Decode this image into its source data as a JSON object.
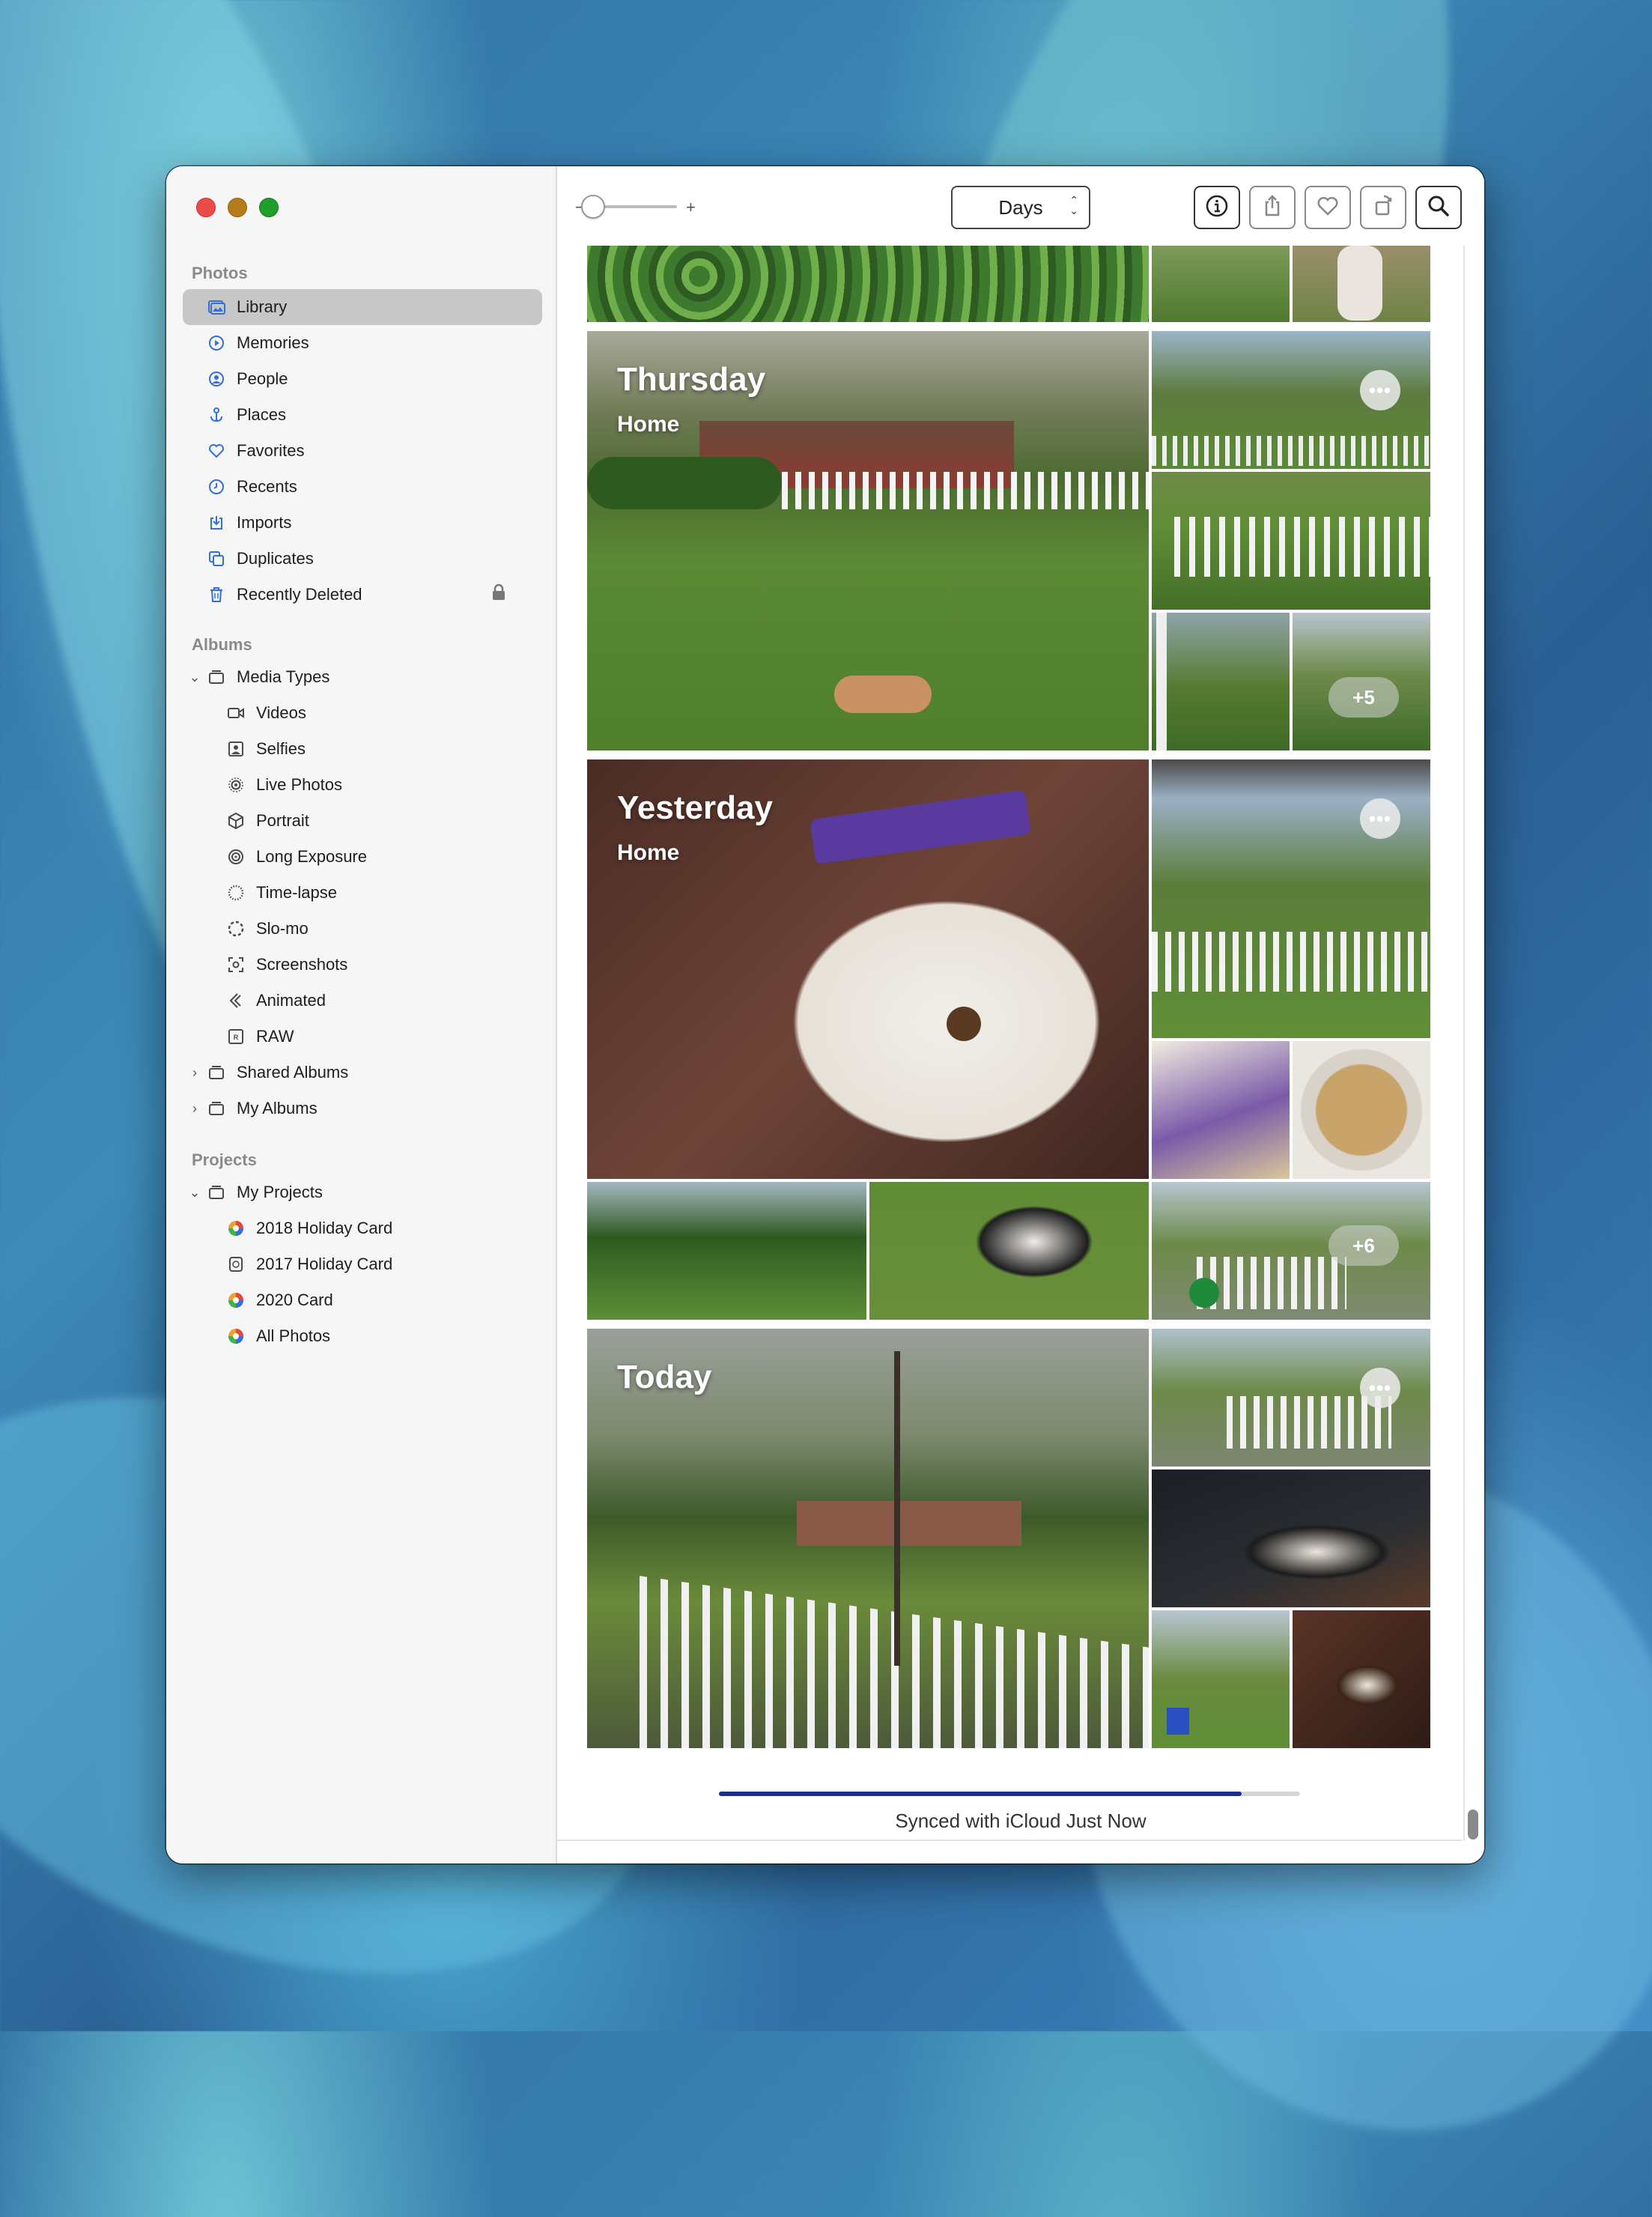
{
  "window": {
    "sidebar": {
      "sections": [
        {
          "title": "Photos",
          "items": [
            {
              "label": "Library",
              "icon": "library-icon",
              "selected": true
            },
            {
              "label": "Memories",
              "icon": "memories-icon"
            },
            {
              "label": "People",
              "icon": "people-icon"
            },
            {
              "label": "Places",
              "icon": "places-icon"
            },
            {
              "label": "Favorites",
              "icon": "heart-icon"
            },
            {
              "label": "Recents",
              "icon": "clock-icon"
            },
            {
              "label": "Imports",
              "icon": "import-icon"
            },
            {
              "label": "Duplicates",
              "icon": "duplicates-icon"
            },
            {
              "label": "Recently Deleted",
              "icon": "trash-icon",
              "locked": true
            }
          ]
        },
        {
          "title": "Albums",
          "items": [
            {
              "label": "Media Types",
              "icon": "folder-icon",
              "expanded": true
            },
            {
              "label": "Videos",
              "icon": "video-icon"
            },
            {
              "label": "Selfies",
              "icon": "selfie-icon"
            },
            {
              "label": "Live Photos",
              "icon": "live-photo-icon"
            },
            {
              "label": "Portrait",
              "icon": "portrait-icon"
            },
            {
              "label": "Long Exposure",
              "icon": "long-exposure-icon"
            },
            {
              "label": "Time-lapse",
              "icon": "timelapse-icon"
            },
            {
              "label": "Slo-mo",
              "icon": "slomo-icon"
            },
            {
              "label": "Screenshots",
              "icon": "screenshot-icon"
            },
            {
              "label": "Animated",
              "icon": "animated-icon"
            },
            {
              "label": "RAW",
              "icon": "raw-icon"
            },
            {
              "label": "Shared Albums",
              "icon": "folder-icon",
              "expanded": false
            },
            {
              "label": "My Albums",
              "icon": "folder-icon",
              "expanded": false
            }
          ]
        },
        {
          "title": "Projects",
          "items": [
            {
              "label": "My Projects",
              "icon": "folder-icon",
              "expanded": true
            },
            {
              "label": "2018 Holiday Card",
              "icon": "card-icon"
            },
            {
              "label": "2017 Holiday Card",
              "icon": "card-outline-icon"
            },
            {
              "label": "2020 Card",
              "icon": "card-icon"
            },
            {
              "label": "All Photos",
              "icon": "card-icon"
            }
          ]
        }
      ]
    },
    "toolbar": {
      "slider_minus": "−",
      "slider_plus": "+",
      "view_select": "Days",
      "buttons": [
        "info-icon",
        "share-icon",
        "heart-icon",
        "rotate-icon",
        "search-icon"
      ]
    },
    "days": [
      {
        "title": "Thursday",
        "location": "Home",
        "more": "+5"
      },
      {
        "title": "Yesterday",
        "location": "Home",
        "more": "+6"
      },
      {
        "title": "Today",
        "location": ""
      }
    ],
    "more_button": "•••",
    "status": {
      "text": "Synced with iCloud Just Now",
      "progress": 0.9
    },
    "colors": {
      "accent": "#2f6fe0",
      "selected_bg": "#c7c7c7",
      "progress": "#1f2d8a"
    }
  }
}
